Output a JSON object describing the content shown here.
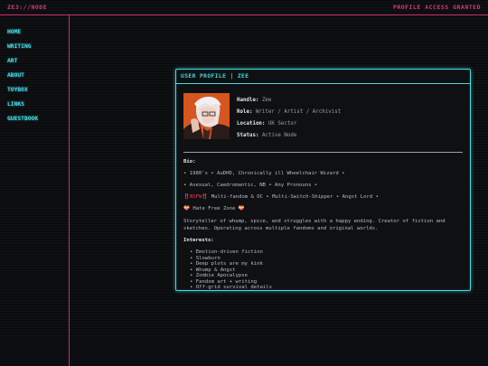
{
  "header": {
    "brand": "ZE3://NODE",
    "status": "PROFILE ACCESS GRANTED"
  },
  "nav": [
    "HOME",
    "WRITING",
    "ART",
    "ABOUT",
    "TOYBOX",
    "LINKS",
    "GUESTBOOK"
  ],
  "profile": {
    "title": "USER PROFILE | ZEE",
    "fields": [
      {
        "key": "Handle:",
        "value": "Zee"
      },
      {
        "key": "Role:",
        "value": "Writer / Artist / Archivist"
      },
      {
        "key": "Location:",
        "value": "UK Sector"
      },
      {
        "key": "Status:",
        "value": "Active Node"
      }
    ],
    "bio_heading": "Bio:",
    "bio_line1": "• 1980's • AuDHD, Chronically ill Wheelchair Wizard •",
    "bio_line2": "• Asexual, Caedromantic, NB • Any Pronouns •",
    "nsfw_mark": "‼️NSFW‼️",
    "bio_line3": " Multi-fandom & OC • Multi-Switch-Shipper • Angst Lord •",
    "hate_free_left": "💝",
    "hate_free_text": " Hate Free Zone ",
    "hate_free_right": "💝",
    "description": "Storyteller of whump, spice, and struggles with a happy ending. Creator of fiction and sketches. Operating across multiple fandoms and original worlds.",
    "interests_heading": "Interests:",
    "interests": [
      "Emotion-driven fiction",
      "Slowburn",
      "Deep plots are my kink",
      "Whump & Angst",
      "Zombie Apocalypse",
      "Fandom art + writing",
      "Off-grid survival details"
    ]
  },
  "colors": {
    "accent_cyan": "#45d8e0",
    "accent_pink": "#c2306c",
    "background": "#0b0c0e"
  },
  "icons": {
    "avatar": "avatar-illustration"
  }
}
